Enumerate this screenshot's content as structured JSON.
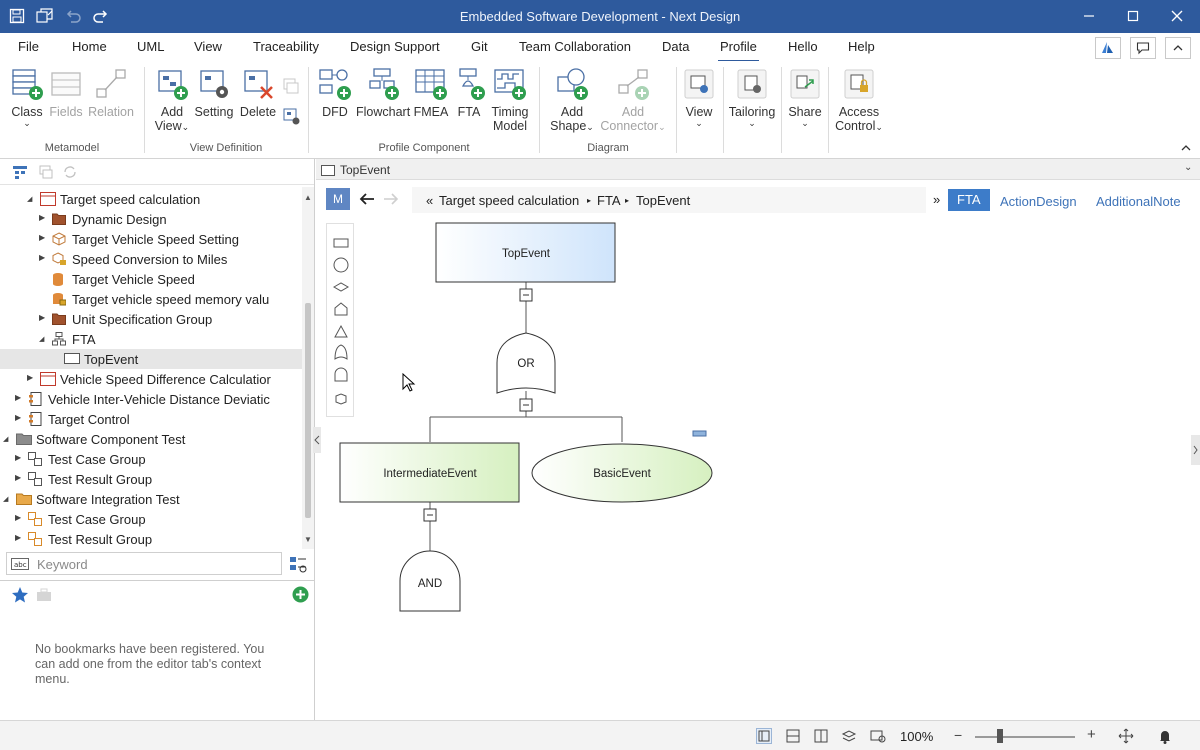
{
  "window": {
    "title": "Embedded Software Development - Next Design",
    "controls": [
      "minimize-icon",
      "maximize-icon",
      "close-icon"
    ]
  },
  "menu": {
    "tabs": [
      "File",
      "Home",
      "UML",
      "View",
      "Traceability",
      "Design Support",
      "Git",
      "Team Collaboration",
      "Data",
      "Profile",
      "Hello",
      "Help"
    ],
    "active": "Profile"
  },
  "ribbon": {
    "metamodel": {
      "label": "Metamodel",
      "class": "Class",
      "fields": "Fields",
      "relation": "Relation"
    },
    "view_definition": {
      "label": "View Definition",
      "add_view_1": "Add",
      "add_view_2": "View",
      "setting": "Setting",
      "delete": "Delete"
    },
    "profile_component": {
      "label": "Profile Component",
      "dfd": "DFD",
      "flowchart": "Flowchart",
      "fmea": "FMEA",
      "fta": "FTA",
      "timing_1": "Timing",
      "timing_2": "Model"
    },
    "diagram": {
      "label": "Diagram",
      "add_shape_1": "Add",
      "add_shape_2": "Shape",
      "add_connector_1": "Add",
      "add_connector_2": "Connector"
    },
    "view": "View",
    "tailoring": "Tailoring",
    "share": "Share",
    "access_1": "Access",
    "access_2": "Control"
  },
  "tree": {
    "items": [
      {
        "label": "Target speed calculation",
        "icon": "model-icon",
        "level": 3,
        "expanded": true
      },
      {
        "label": "Dynamic Design",
        "icon": "folder-icon",
        "level": 4,
        "expanded": false
      },
      {
        "label": "Target Vehicle Speed Setting",
        "icon": "cube-icon",
        "level": 4,
        "expanded": false
      },
      {
        "label": "Speed Conversion to Miles",
        "icon": "cube-lock-icon",
        "level": 4,
        "expanded": false
      },
      {
        "label": "Target Vehicle Speed",
        "icon": "cylinder-icon",
        "level": 4,
        "expanded": null
      },
      {
        "label": "Target vehicle speed memory valu",
        "icon": "cylinder-lock-icon",
        "level": 4,
        "expanded": null
      },
      {
        "label": "Unit Specification Group",
        "icon": "folder-icon",
        "level": 4,
        "expanded": false
      },
      {
        "label": "FTA",
        "icon": "diagram-icon",
        "level": 4,
        "expanded": true
      },
      {
        "label": "TopEvent",
        "icon": "rectangle-icon",
        "level": 5,
        "expanded": null,
        "selected": true
      },
      {
        "label": "Vehicle Speed Difference Calculatior",
        "icon": "model-icon",
        "level": 3,
        "expanded": false
      },
      {
        "label": "Vehicle Inter-Vehicle Distance Deviatic",
        "icon": "component-icon",
        "level": 2,
        "expanded": false
      },
      {
        "label": "Target Control",
        "icon": "component-icon",
        "level": 2,
        "expanded": false
      },
      {
        "label": "Software Component Test",
        "icon": "folder-gray-icon",
        "level": 1,
        "expanded": true
      },
      {
        "label": "Test Case Group",
        "icon": "test-group-icon",
        "level": 2,
        "expanded": false
      },
      {
        "label": "Test Result Group",
        "icon": "test-group-icon",
        "level": 2,
        "expanded": false
      },
      {
        "label": "Software Integration Test",
        "icon": "folder-orange-icon",
        "level": 1,
        "expanded": true
      },
      {
        "label": "Test Case Group",
        "icon": "test-group-orange-icon",
        "level": 2,
        "expanded": false
      },
      {
        "label": "Test Result Group",
        "icon": "test-group-orange-icon",
        "level": 2,
        "expanded": false
      }
    ]
  },
  "search": {
    "placeholder": "Keyword"
  },
  "bookmarks": {
    "message": "No bookmarks have been registered. You can add one from the editor tab's context menu."
  },
  "editor": {
    "tab_title": "TopEvent",
    "mode_button": "M",
    "breadcrumb": {
      "open": "«",
      "items": [
        "Target speed calculation",
        "FTA",
        "TopEvent"
      ],
      "more": "»"
    },
    "view_tabs": [
      "FTA",
      "ActionDesign",
      "AdditionalNote"
    ],
    "active_view": "FTA",
    "diagram": {
      "top_event": "TopEvent",
      "or_gate": "OR",
      "intermediate_event": "IntermediateEvent",
      "basic_event": "BasicEvent",
      "and_gate": "AND"
    }
  },
  "status": {
    "zoom": "100%"
  },
  "colors": {
    "accent": "#2e5a9d",
    "active_view": "#3d7cc9",
    "link": "#3e73b8"
  }
}
